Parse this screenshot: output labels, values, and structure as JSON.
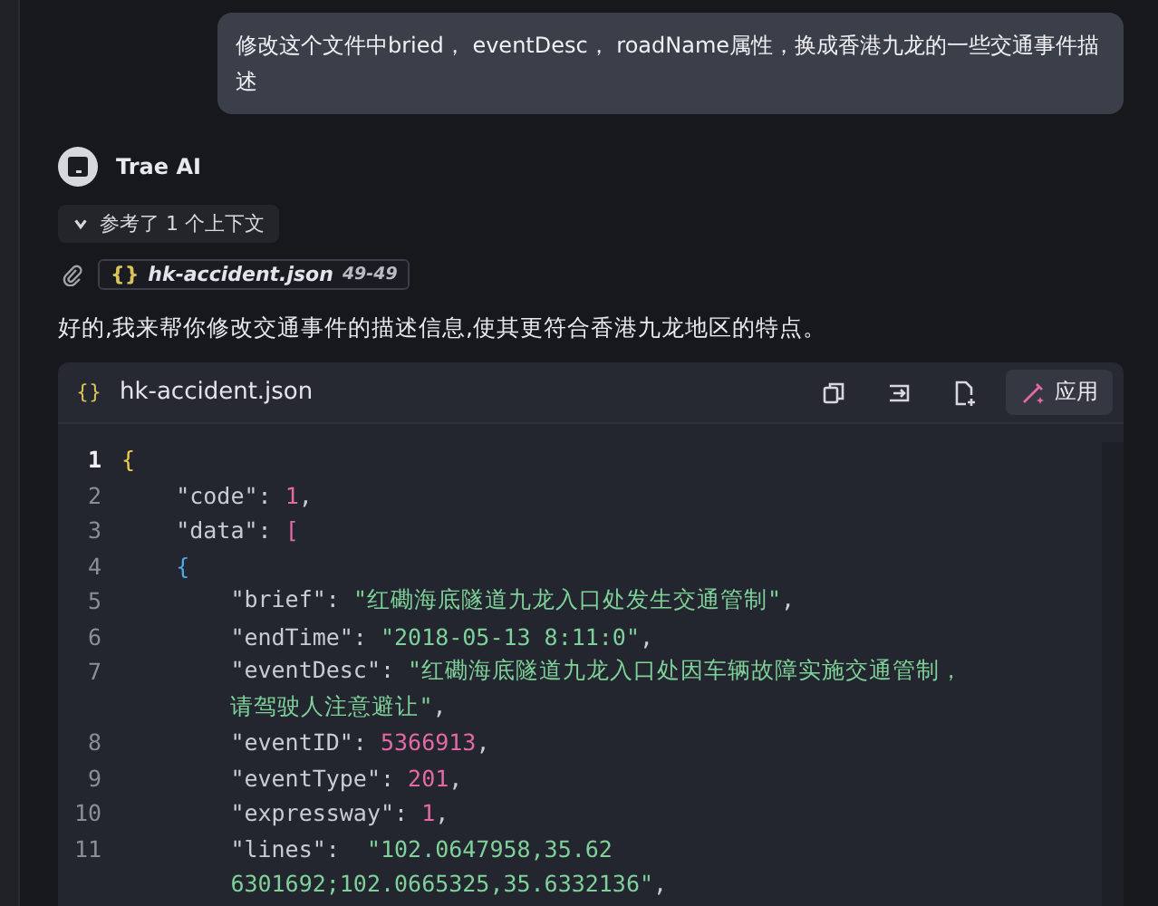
{
  "user_message": "修改这个文件中bried， eventDesc， roadName属性，换成香港九龙的一些交通事件描述",
  "assistant": {
    "name": "Trae AI",
    "context_toggle": {
      "label": "参考了 1 个上下文",
      "expanded": false
    },
    "context_file": {
      "icon_text": "{}",
      "name": "hk-accident.json",
      "range": "49-49"
    },
    "reply": "好的,我来帮你修改交通事件的描述信息,使其更符合香港九龙地区的特点。",
    "code_block": {
      "icon_text": "{}",
      "file_name": "hk-accident.json",
      "apply_label": "应用",
      "lines": [
        {
          "number": "1",
          "current": true,
          "tokens": [
            {
              "kind": "brace",
              "text": "{"
            }
          ]
        },
        {
          "number": "2",
          "current": false,
          "tokens": [
            {
              "kind": "plain",
              "text": "    \"code\": "
            },
            {
              "kind": "number",
              "text": "1"
            },
            {
              "kind": "plain",
              "text": ","
            }
          ]
        },
        {
          "number": "3",
          "current": false,
          "tokens": [
            {
              "kind": "plain",
              "text": "    \"data\": "
            },
            {
              "kind": "bracket",
              "text": "["
            }
          ]
        },
        {
          "number": "4",
          "current": false,
          "tokens": [
            {
              "kind": "inner",
              "text": "    {"
            }
          ]
        },
        {
          "number": "5",
          "current": false,
          "tokens": [
            {
              "kind": "plain",
              "text": "        \"brief\": "
            },
            {
              "kind": "string",
              "text": "\"红磡海底隧道九龙入口处发生交通管制\""
            },
            {
              "kind": "plain",
              "text": ","
            }
          ]
        },
        {
          "number": "6",
          "current": false,
          "tokens": [
            {
              "kind": "plain",
              "text": "        \"endTime\": "
            },
            {
              "kind": "string",
              "text": "\"2018-05-13 8:11:0\""
            },
            {
              "kind": "plain",
              "text": ","
            }
          ]
        },
        {
          "number": "7",
          "current": false,
          "tokens": [
            {
              "kind": "plain",
              "text": "        \"eventDesc\": "
            },
            {
              "kind": "string",
              "text": "\"红磡海底隧道九龙入口处因车辆故障实施交通管制，"
            }
          ]
        },
        {
          "tokens": [
            {
              "kind": "string",
              "text": "        请驾驶人注意避让\""
            },
            {
              "kind": "plain",
              "text": ","
            }
          ]
        },
        {
          "number": "8",
          "current": false,
          "tokens": [
            {
              "kind": "plain",
              "text": "        \"eventID\": "
            },
            {
              "kind": "number",
              "text": "5366913"
            },
            {
              "kind": "plain",
              "text": ","
            }
          ]
        },
        {
          "number": "9",
          "current": false,
          "tokens": [
            {
              "kind": "plain",
              "text": "        \"eventType\": "
            },
            {
              "kind": "number",
              "text": "201"
            },
            {
              "kind": "plain",
              "text": ","
            }
          ]
        },
        {
          "number": "10",
          "current": false,
          "tokens": [
            {
              "kind": "plain",
              "text": "        \"expressway\": "
            },
            {
              "kind": "number",
              "text": "1"
            },
            {
              "kind": "plain",
              "text": ","
            }
          ]
        },
        {
          "number": "11",
          "current": false,
          "tokens": [
            {
              "kind": "plain",
              "text": "        \"lines\":  "
            },
            {
              "kind": "string",
              "text": "\"102.0647958,35.62"
            }
          ]
        },
        {
          "tokens": [
            {
              "kind": "string",
              "text": "        6301692;102.0665325,35.6332136\""
            },
            {
              "kind": "plain",
              "text": ","
            }
          ]
        }
      ]
    }
  }
}
